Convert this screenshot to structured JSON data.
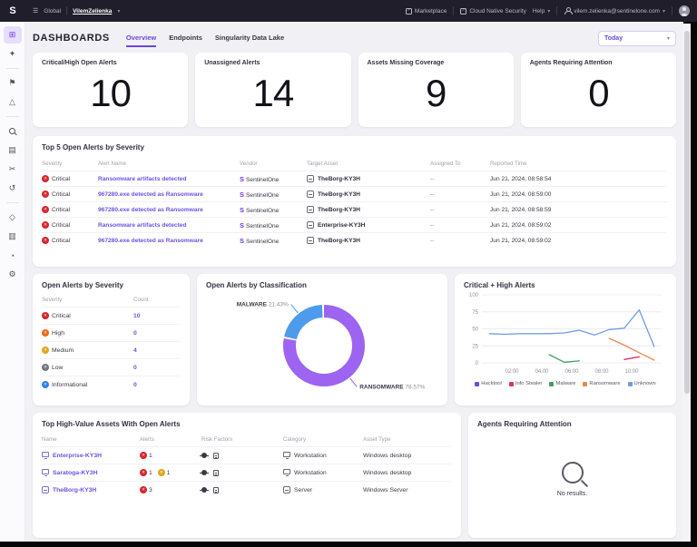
{
  "topbar": {
    "logo": "S",
    "scope_label": "Global",
    "scope_name": "VilemZelienka",
    "marketplace": "Marketplace",
    "cloud_native_security": "Cloud Native Security",
    "help": "Help",
    "user_email": "vilem.zelienka@sentinelone.com"
  },
  "sidebar": {
    "items": [
      "dashboards",
      "explore",
      "|",
      "incidents",
      "alerts",
      "|",
      "search",
      "events",
      "automation",
      "activity",
      "|",
      "assets",
      "docs",
      "reports",
      "settings"
    ],
    "active": "dashboards"
  },
  "header": {
    "title": "DASHBOARDS",
    "tabs": [
      {
        "label": "Overview",
        "active": true
      },
      {
        "label": "Endpoints",
        "active": false
      },
      {
        "label": "Singularity Data Lake",
        "active": false
      }
    ],
    "time_filter": "Today"
  },
  "stat_cards": [
    {
      "label": "Critical/High Open Alerts",
      "value": "10"
    },
    {
      "label": "Unassigned Alerts",
      "value": "14"
    },
    {
      "label": "Assets Missing Coverage",
      "value": "9"
    },
    {
      "label": "Agents Requiring Attention",
      "value": "0"
    }
  ],
  "top_alerts": {
    "title": "Top 5 Open Alerts by Severity",
    "columns": [
      "Severity",
      "Alert Name",
      "Vendor",
      "Target Asset",
      "Assigned To",
      "Reported Time"
    ],
    "severity_color": "#d7262e",
    "rows": [
      {
        "severity": "Critical",
        "alert_name": "Ransomware artifacts detected",
        "vendor": "SentinelOne",
        "target_asset": "TheBorg-KY3H",
        "assigned_to": "--",
        "reported_time": "Jun 21, 2024, 08:58:54"
      },
      {
        "severity": "Critical",
        "alert_name": "967280.exe detected as Ransomware",
        "vendor": "SentinelOne",
        "target_asset": "TheBorg-KY3H",
        "assigned_to": "--",
        "reported_time": "Jun 21, 2024, 08:59:00"
      },
      {
        "severity": "Critical",
        "alert_name": "967280.exe detected as Ransomware",
        "vendor": "SentinelOne",
        "target_asset": "TheBorg-KY3H",
        "assigned_to": "--",
        "reported_time": "Jun 21, 2024, 08:58:59"
      },
      {
        "severity": "Critical",
        "alert_name": "Ransomware artifacts detected",
        "vendor": "SentinelOne",
        "target_asset": "Enterprise-KY3H",
        "assigned_to": "--",
        "reported_time": "Jun 21, 2024, 08:59:02"
      },
      {
        "severity": "Critical",
        "alert_name": "967280.exe detected as Ransomware",
        "vendor": "SentinelOne",
        "target_asset": "TheBorg-KY3H",
        "assigned_to": "--",
        "reported_time": "Jun 21, 2024, 08:59:02"
      }
    ]
  },
  "severity_panel": {
    "title": "Open Alerts by Severity",
    "columns": [
      "Severity",
      "Count"
    ],
    "rows": [
      {
        "severity": "Critical",
        "color": "#d7262e",
        "count": "10"
      },
      {
        "severity": "High",
        "color": "#f06618",
        "count": "0"
      },
      {
        "severity": "Medium",
        "color": "#dfa51f",
        "count": "4"
      },
      {
        "severity": "Low",
        "color": "#707684",
        "count": "0"
      },
      {
        "severity": "Informational",
        "color": "#2f80ed",
        "count": "0"
      }
    ]
  },
  "chart_data": [
    {
      "type": "pie",
      "variant": "donut",
      "title": "Open Alerts by Classification",
      "slices": [
        {
          "label": "RANSOMWARE",
          "value": 78.57,
          "color": "#9c64f0"
        },
        {
          "label": "MALWARE",
          "value": 21.43,
          "color": "#4d9bea"
        }
      ]
    },
    {
      "type": "line",
      "title": "Critical + High Alerts",
      "xlim": [
        0,
        12
      ],
      "ylim": [
        0,
        100
      ],
      "yticks": [
        0,
        25,
        50,
        75,
        100
      ],
      "xticks": [
        {
          "v": 2,
          "label": "02:00"
        },
        {
          "v": 4,
          "label": "04:00"
        },
        {
          "v": 6,
          "label": "06:00"
        },
        {
          "v": 8,
          "label": "08:00"
        },
        {
          "v": 10,
          "label": "10:00"
        }
      ],
      "series": [
        {
          "name": "Hacktool",
          "color": "#7048e8",
          "x": [],
          "y": []
        },
        {
          "name": "Info Stealer",
          "color": "#d6336c",
          "x": [
            9.5,
            10.5
          ],
          "y": [
            5,
            9
          ]
        },
        {
          "name": "Malware",
          "color": "#40a060",
          "x": [
            4.5,
            5.5,
            6.5
          ],
          "y": [
            12,
            1,
            3
          ]
        },
        {
          "name": "Ransomware",
          "color": "#e8884f",
          "x": [
            8.5,
            9.5,
            10.5,
            11.5
          ],
          "y": [
            36,
            26,
            15,
            4
          ]
        },
        {
          "name": "Unknown",
          "color": "#6f9ce0",
          "x": [
            0.5,
            1.5,
            2.5,
            3.5,
            4.5,
            5.5,
            6.5,
            7.5,
            8.5,
            9.5,
            10.5,
            11.5
          ],
          "y": [
            43,
            42,
            43,
            43,
            43,
            44,
            48,
            41,
            49,
            51,
            78,
            24
          ]
        }
      ],
      "legend": [
        "Hacktool",
        "Info Stealer",
        "Malware",
        "Ransomware",
        "Unknown"
      ],
      "legend_position": "bottom"
    }
  ],
  "assets_panel": {
    "title": "Top High-Value Assets With Open Alerts",
    "columns": [
      "Name",
      "Alerts",
      "Risk Factors",
      "Category",
      "Asset Type"
    ],
    "rows": [
      {
        "name": "Enterprise-KY3H",
        "icon": "desktop",
        "alerts": [
          {
            "color": "#d7262e",
            "count": "1"
          }
        ],
        "category": "Workstation",
        "category_icon": "desktop",
        "asset_type": "Windows desktop"
      },
      {
        "name": "Saratoga-KY3H",
        "icon": "desktop",
        "alerts": [
          {
            "color": "#d7262e",
            "count": "1"
          },
          {
            "color": "#dfa51f",
            "count": "1"
          }
        ],
        "category": "Workstation",
        "category_icon": "desktop",
        "asset_type": "Windows desktop"
      },
      {
        "name": "TheBorg-KY3H",
        "icon": "server",
        "alerts": [
          {
            "color": "#d7262e",
            "count": "3"
          }
        ],
        "category": "Server",
        "category_icon": "server",
        "asset_type": "Windows Server"
      }
    ]
  },
  "agents_panel": {
    "title": "Agents Requiring Attention",
    "empty_text": "No results."
  }
}
